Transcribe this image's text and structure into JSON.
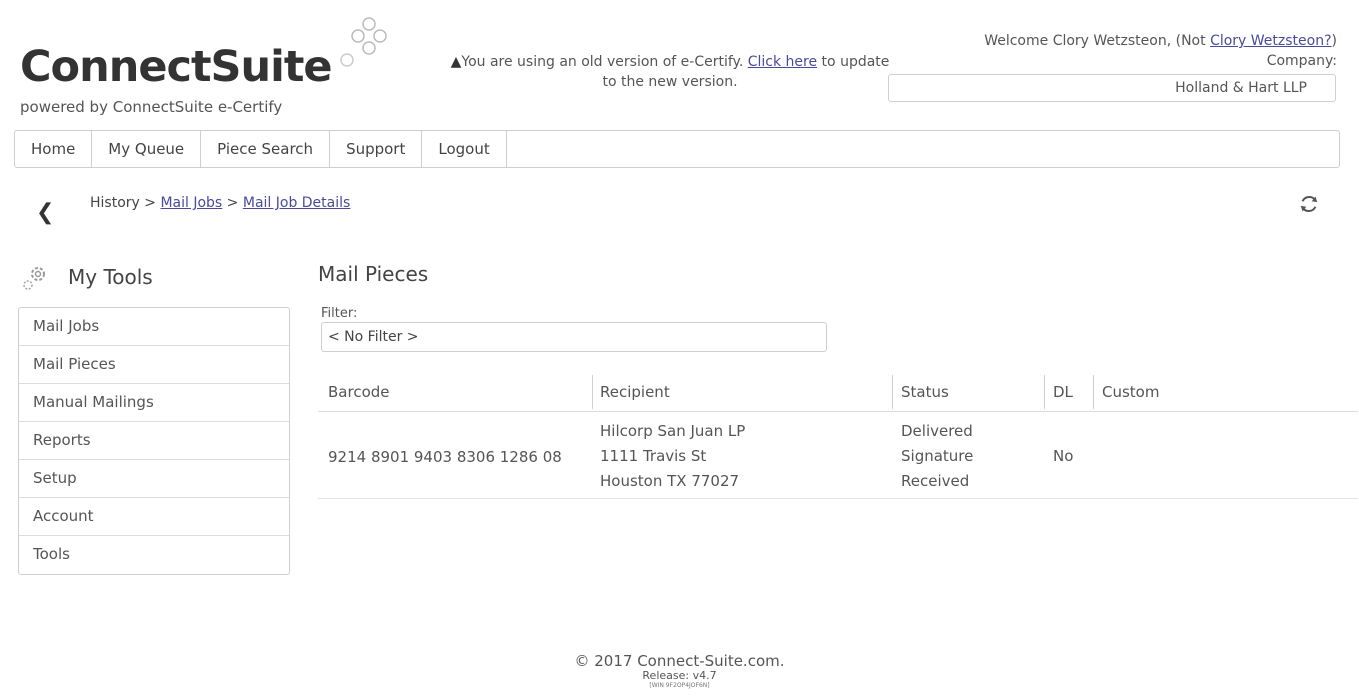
{
  "brand": {
    "name": "ConnectSuite",
    "tagline": "powered by ConnectSuite e-Certify"
  },
  "notice": {
    "before_link": "You are using an old version of e-Certify. ",
    "link_text": "Click here",
    "after_link": " to update to the new version."
  },
  "user": {
    "welcome_prefix": "Welcome Clory Wetzsteon, (Not ",
    "switch_link": "Clory Wetzsteon?",
    "welcome_suffix": ")",
    "company_label": "Company:",
    "company": "Holland & Hart LLP"
  },
  "nav": [
    "Home",
    "My Queue",
    "Piece Search",
    "Support",
    "Logout"
  ],
  "breadcrumb": {
    "root": "History",
    "sep": ">",
    "mail_jobs": "Mail Jobs",
    "details": "Mail Job Details"
  },
  "sidebar": {
    "title": "My Tools",
    "items": [
      "Mail Jobs",
      "Mail Pieces",
      "Manual Mailings",
      "Reports",
      "Setup",
      "Account",
      "Tools"
    ]
  },
  "main": {
    "title": "Mail Pieces",
    "filter_label": "Filter:",
    "filter_value": "< No Filter >",
    "columns": [
      "Barcode",
      "Recipient",
      "Status",
      "DL",
      "Custom"
    ],
    "rows": [
      {
        "barcode": "9214 8901 9403 8306 1286 08",
        "recipient": [
          "Hilcorp San Juan LP",
          "1111 Travis St",
          "Houston TX 77027"
        ],
        "status": [
          "Delivered",
          "Signature",
          "Received"
        ],
        "dl": "No",
        "custom": ""
      }
    ]
  },
  "footer": {
    "copyright": "© 2017 Connect-Suite.com.",
    "release": "Release: v4.7",
    "build": "[WIN 9F2OP4JOF6N]"
  },
  "colors": {
    "border": "#cfcfcf",
    "link": "#4a4a9a",
    "text": "#444444"
  }
}
